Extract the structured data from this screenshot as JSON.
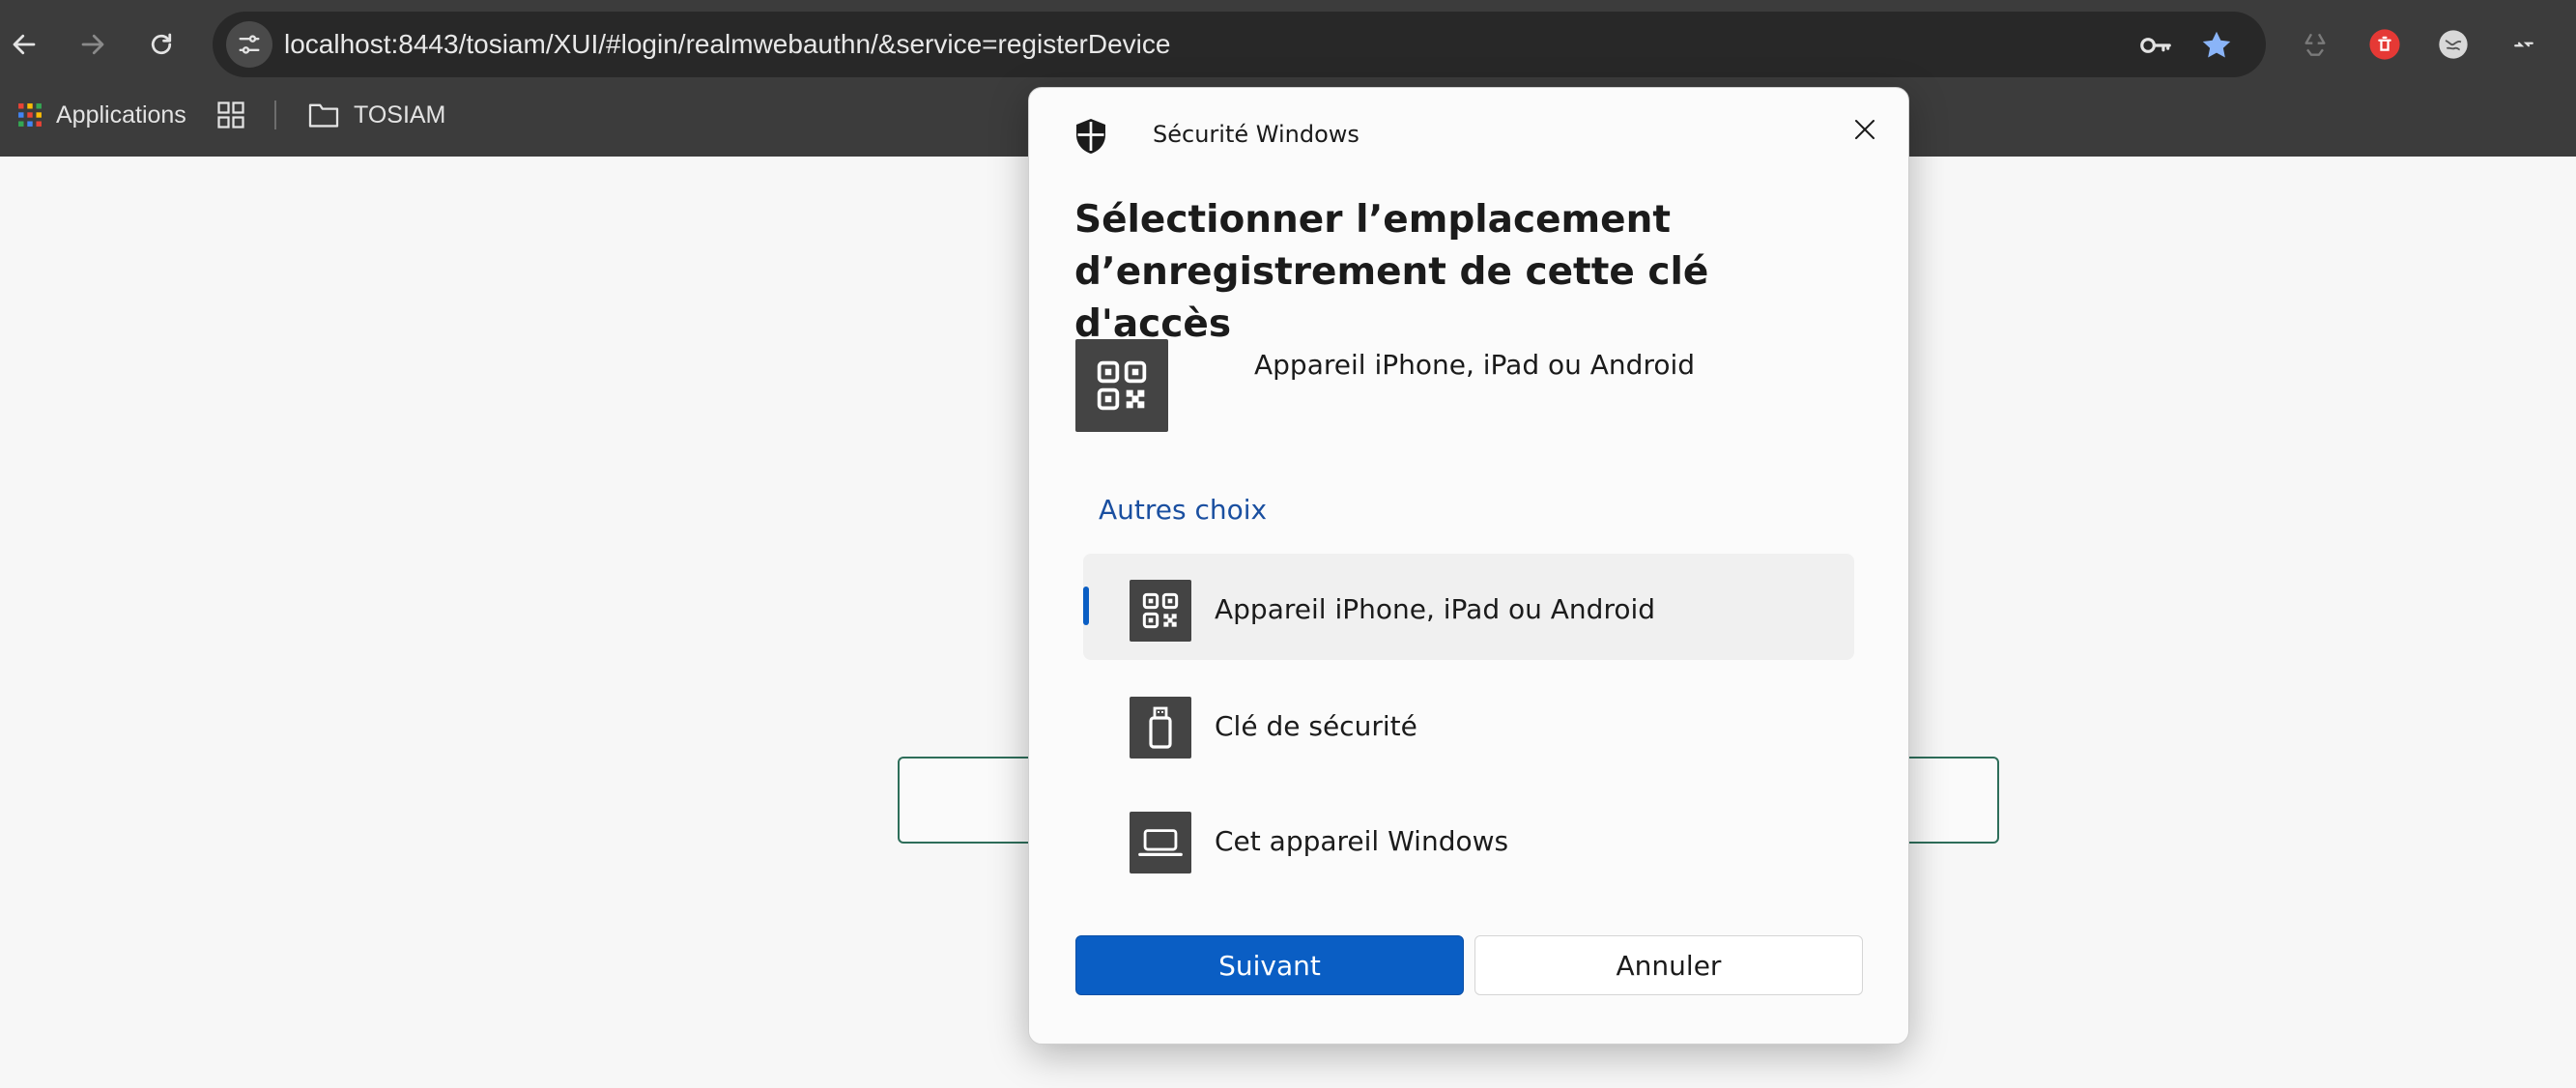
{
  "browser": {
    "url": "localhost:8443/tosiam/XUI/#login/realmwebauthn/&service=registerDevice",
    "bookmarks": {
      "apps_label": "Applications",
      "folder_label": "TOSIAM"
    },
    "colors": {
      "star": "#8ab4f8",
      "extension_red": "#e53935"
    }
  },
  "dialog": {
    "caption": "Sécurité Windows",
    "title_line1": "Sélectionner l’emplacement",
    "title_line2": "d’enregistrement de cette clé d'accès",
    "primary_option": {
      "label": "Appareil iPhone, iPad ou Android",
      "icon": "qr-code-icon"
    },
    "other_heading": "Autres choix",
    "options": [
      {
        "label": "Appareil iPhone, iPad ou Android",
        "icon": "qr-code-icon",
        "selected": true
      },
      {
        "label": "Clé de sécurité",
        "icon": "usb-key-icon",
        "selected": false
      },
      {
        "label": "Cet appareil Windows",
        "icon": "laptop-icon",
        "selected": false
      }
    ],
    "next_label": "Suivant",
    "cancel_label": "Annuler",
    "colors": {
      "accent": "#0a5ec4",
      "heading_link": "#1a4fa0"
    }
  }
}
